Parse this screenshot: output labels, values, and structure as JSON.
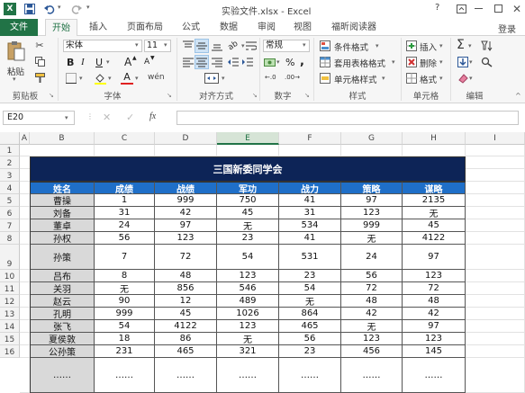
{
  "window": {
    "title": "实验文件.xlsx - Excel",
    "help": "?",
    "login": "登录"
  },
  "tabs": [
    "文件",
    "开始",
    "插入",
    "页面布局",
    "公式",
    "数据",
    "审阅",
    "视图",
    "福昕阅读器"
  ],
  "ribbon": {
    "paste": "粘贴",
    "font_name": "宋体",
    "font_size": "11",
    "bold": "B",
    "italic": "I",
    "underline": "U",
    "grow_font": "A",
    "shrink_font": "A",
    "number_format": "常规",
    "percent": "%",
    "comma": ",",
    "cond_format": "条件格式",
    "table_format": "套用表格格式",
    "cell_style": "单元格样式",
    "insert": "插入",
    "delete": "删除",
    "format": "格式",
    "groups": [
      "剪贴板",
      "字体",
      "对齐方式",
      "数字",
      "样式",
      "单元格",
      "编辑"
    ]
  },
  "formula_bar": {
    "name_box": "E20",
    "fx": "fx",
    "content": ""
  },
  "columns": [
    "A",
    "B",
    "C",
    "D",
    "E",
    "F",
    "G",
    "H",
    "I"
  ],
  "rows": [
    "1",
    "2",
    "3",
    "4",
    "5",
    "6",
    "7",
    "8",
    "9",
    "10",
    "11",
    "12",
    "13",
    "14",
    "15",
    "16"
  ],
  "table": {
    "title": "三国新委同学会",
    "headers": [
      "姓名",
      "成绩",
      "战绩",
      "军功",
      "战力",
      "策略",
      "谋略"
    ],
    "data": [
      [
        "曹操",
        "1",
        "999",
        "750",
        "41",
        "97",
        "2135"
      ],
      [
        "刘备",
        "31",
        "42",
        "45",
        "31",
        "123",
        "无"
      ],
      [
        "董卓",
        "24",
        "97",
        "无",
        "534",
        "999",
        "45"
      ],
      [
        "孙权",
        "56",
        "123",
        "23",
        "41",
        "无",
        "4122"
      ],
      [
        "孙策",
        "7",
        "72",
        "54",
        "531",
        "24",
        "97"
      ],
      [
        "吕布",
        "8",
        "48",
        "123",
        "23",
        "56",
        "123"
      ],
      [
        "关羽",
        "无",
        "856",
        "546",
        "54",
        "72",
        "72"
      ],
      [
        "赵云",
        "90",
        "12",
        "489",
        "无",
        "48",
        "48"
      ],
      [
        "孔明",
        "999",
        "45",
        "1026",
        "864",
        "42",
        "42"
      ],
      [
        "张飞",
        "54",
        "4122",
        "123",
        "465",
        "无",
        "97"
      ],
      [
        "夏侯敦",
        "18",
        "86",
        "无",
        "56",
        "123",
        "123"
      ],
      [
        "公孙策",
        "231",
        "465",
        "321",
        "23",
        "456",
        "145"
      ],
      [
        "……",
        "……",
        "……",
        "……",
        "……",
        "……",
        "……"
      ]
    ]
  },
  "colors": {
    "title_bg": "#0d2457",
    "header_bg": "#1f6fc8",
    "name_bg": "#d9d9d9",
    "excel_green": "#217346"
  }
}
